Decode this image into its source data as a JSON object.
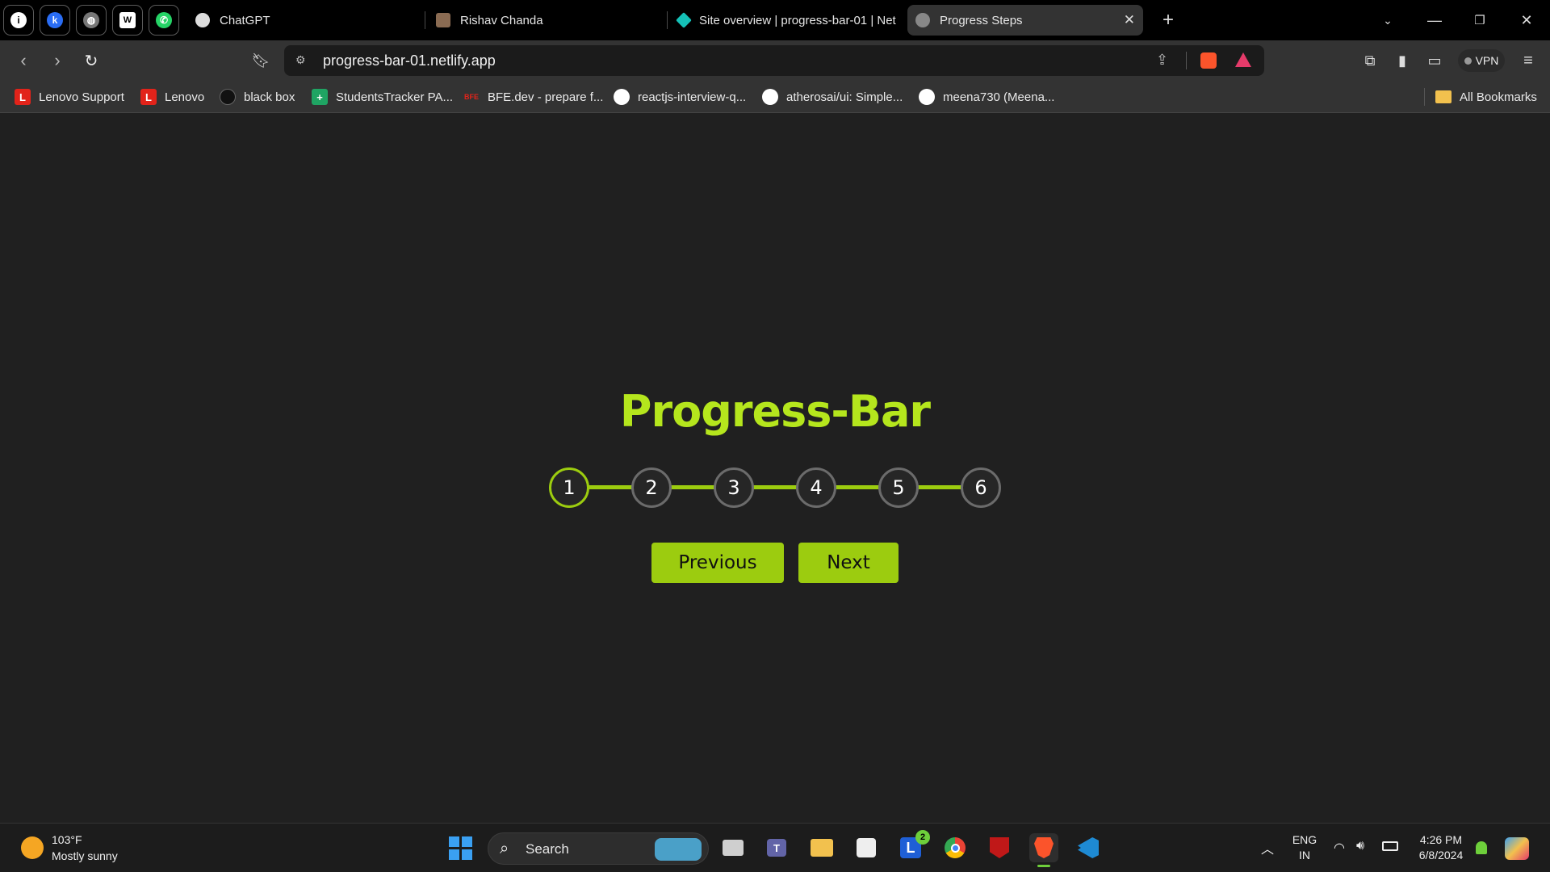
{
  "browser": {
    "pinned_tabs": [
      {
        "icon": "info-icon",
        "color": "#1a73e8"
      },
      {
        "icon": "kaspersky-icon",
        "color": "#2a6df4"
      },
      {
        "icon": "globe-icon",
        "color": "#777777"
      },
      {
        "icon": "wikipedia-icon",
        "color": "#ffffff"
      },
      {
        "icon": "whatsapp-icon",
        "color": "#25d366"
      }
    ],
    "tabs": [
      {
        "label": "ChatGPT",
        "icon": "chatgpt-icon"
      },
      {
        "label": "Rishav Chanda",
        "icon": "profile-photo-icon"
      },
      {
        "label": "Site overview | progress-bar-01 | Net",
        "icon": "netlify-icon"
      },
      {
        "label": "Progress Steps",
        "icon": "globe-icon",
        "active": true
      }
    ],
    "new_tab": "+",
    "url": "progress-bar-01.netlify.app",
    "vpn_label": "VPN"
  },
  "bookmarks": [
    {
      "label": "Lenovo Support",
      "icon": "L",
      "color": "#e2231a"
    },
    {
      "label": "Lenovo",
      "icon": "L",
      "color": "#e2231a"
    },
    {
      "label": "black box",
      "icon": "blackbox-icon",
      "color": "#222222"
    },
    {
      "label": "StudentsTracker PA...",
      "icon": "+",
      "color": "#1fa463"
    },
    {
      "label": "BFE.dev - prepare f...",
      "icon": "BFE",
      "color": "#e2231a"
    },
    {
      "label": "reactjs-interview-q...",
      "icon": "github-icon",
      "color": "#ffffff"
    },
    {
      "label": "atherosai/ui: Simple...",
      "icon": "github-icon",
      "color": "#ffffff"
    },
    {
      "label": "meena730 (Meena...",
      "icon": "github-icon",
      "color": "#ffffff"
    }
  ],
  "all_bookmarks": "All Bookmarks",
  "page": {
    "title": "Progress-Bar",
    "steps": [
      "1",
      "2",
      "3",
      "4",
      "5",
      "6"
    ],
    "active_step": 1,
    "previous_label": "Previous",
    "next_label": "Next",
    "accent_color": "#9ccc0f"
  },
  "taskbar": {
    "weather_temp": "103°F",
    "weather_desc": "Mostly sunny",
    "search_label": "Search",
    "teams_badge": "2",
    "lang_top": "ENG",
    "lang_bottom": "IN",
    "time": "4:26 PM",
    "date": "6/8/2024"
  }
}
